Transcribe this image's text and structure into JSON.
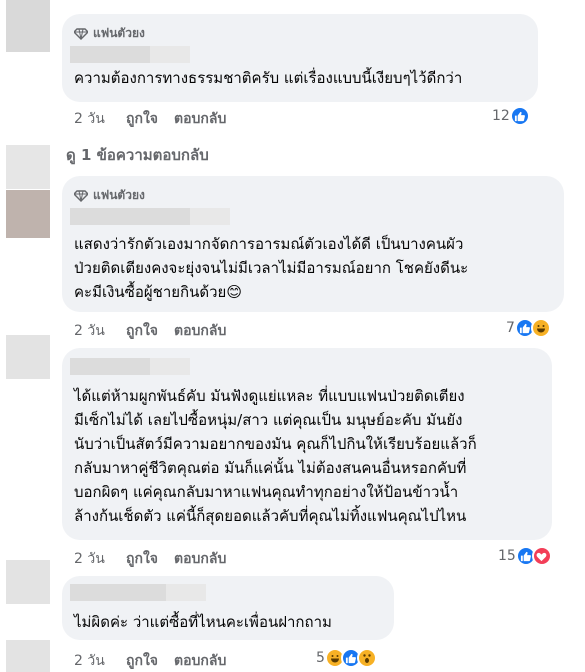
{
  "colors": {
    "like": "#1877f2",
    "love": "#f33e58",
    "haha": "#f7b125",
    "muted": "#65676b",
    "bubble": "#f0f2f5"
  },
  "comments": [
    {
      "badge": "แฟนตัวยง",
      "text": "ความต้องการทางธรรมชาติครับ แต่เรื่องแบบนี้เงียบๆไว้ดีกว่า",
      "time": "2 วัน",
      "like_label": "ถูกใจ",
      "reply_label": "ตอบกลับ",
      "reaction_count": "12",
      "reactions": [
        "like"
      ]
    },
    {
      "badge": "แฟนตัวยง",
      "text": "แสดงว่ารักตัวเองมากจัดการอารมณ์ตัวเองได้ดี เป็นบางคนผัว\nป่วยติดเตียงคงจะยุ่งจนไม่มีเวลาไม่มีอารมณ์อยาก โชคยังดีนะ\nคะมีเงินซื้อผู้ชายกินด้วย😊",
      "time": "2 วัน",
      "like_label": "ถูกใจ",
      "reply_label": "ตอบกลับ",
      "reaction_count": "7",
      "reactions": [
        "like",
        "haha"
      ]
    },
    {
      "text": "ได้แต่ห้ามผูกพันธ์คับ มันฟังดูแย่แหละ ที่แบบแฟนป่วยติดเตียง\nมีเซ็กไม่ได้ เลยไปซื้อหนุ่ม/สาว แต่คุณเป็น มนุษย์อะคับ มันยัง\nนับว่าเป็นสัตว์มีความอยากของมัน คุณก็ไปกินให้เรียบร้อยแล้วก็\nกลับมาหาคู่ชีวิตคุณต่อ มันก็แค่นั้น ไม่ต้องสนคนอื่นหรอกคับที่\nบอกผิดๆ แค่คุณกลับมาหาแฟนคุณทำทุกอย่างให้ป้อนข้าวน้ำ\nล้างก้นเช็ดตัว แค่นี้ก็สุดยอดแล้วคับที่คุณไม่ทิ้งแฟนคุณไปไหน",
      "time": "2 วัน",
      "like_label": "ถูกใจ",
      "reply_label": "ตอบกลับ",
      "reaction_count": "15",
      "reactions": [
        "like",
        "love"
      ]
    },
    {
      "text": "ไม่ผิดค่ะ ว่าแต่ซื้อที่ไหนคะเพื่อนฝากถาม",
      "time": "2 วัน",
      "like_label": "ถูกใจ",
      "reply_label": "ตอบกลับ",
      "reaction_count": "5",
      "reactions": [
        "haha",
        "like",
        "wow"
      ]
    }
  ],
  "view_replies": "ดู 1 ข้อความตอบกลับ"
}
